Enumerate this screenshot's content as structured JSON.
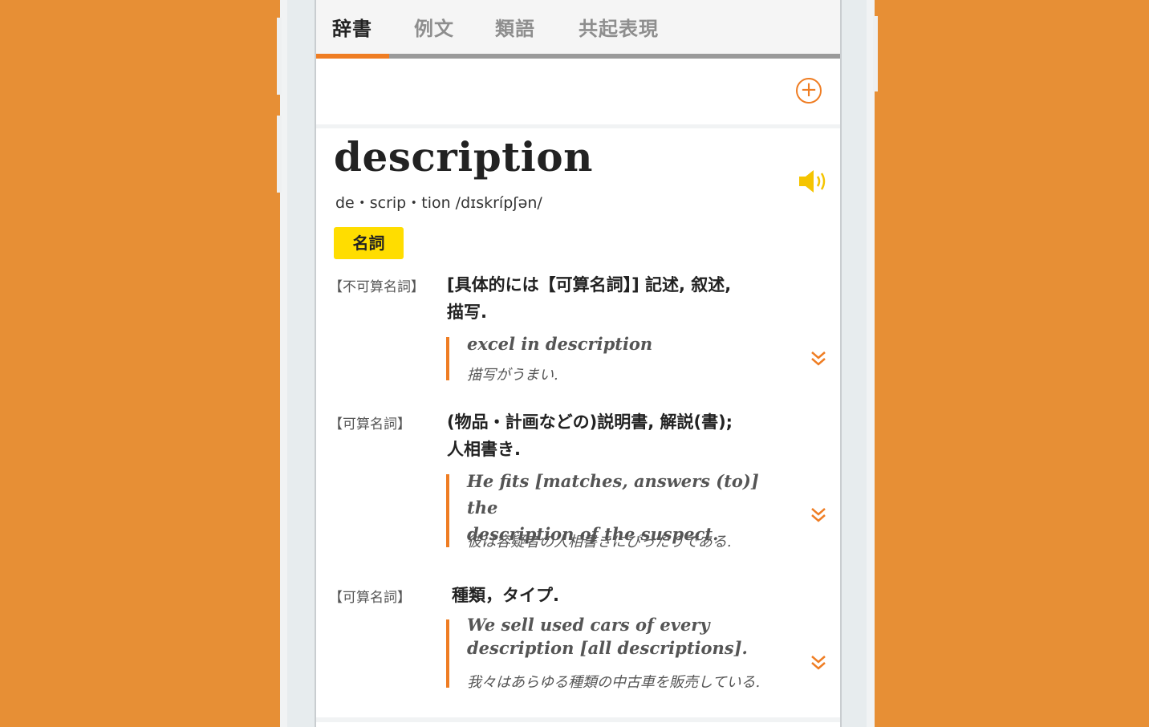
{
  "colors": {
    "background": "#e78f35",
    "accent": "#ef7d23",
    "badge": "#ffdd00",
    "speaker": "#f5c400"
  },
  "tabs": [
    {
      "label": "辞書",
      "active": true
    },
    {
      "label": "例文",
      "active": false
    },
    {
      "label": "類語",
      "active": false
    },
    {
      "label": "共起表現",
      "active": false
    }
  ],
  "toolbar": {
    "add_icon": "plus-circle-icon"
  },
  "entry": {
    "headword": "description",
    "pronunciation": "de・scrip・tion /dɪskrípʃən/",
    "speaker_icon": "speaker-icon",
    "part_of_speech": "名詞"
  },
  "senses": [
    {
      "tag": "【不可算名詞】",
      "def_line1": "[具体的には【可算名詞】] 記述, 叙述,",
      "def_line2": "描写.",
      "example_en_line1": "excel in description",
      "example_en_line2": "",
      "example_ja": "描写がうまい."
    },
    {
      "tag": "【可算名詞】",
      "def_line1": "(物品・計画などの)説明書, 解説(書);",
      "def_line2": "人相書き.",
      "example_en_line1": "He fits [matches, answers (to)] the",
      "example_en_line2": "description of the suspect.",
      "example_ja": "彼は容疑者の人相書きにぴったりである."
    },
    {
      "tag": "【可算名詞】",
      "def_line1": "種類，タイプ.",
      "def_line2": "",
      "example_en_line1": "We sell used cars of every",
      "example_en_line2": "description [all descriptions].",
      "example_ja": "我々はあらゆる種類の中古車を販売している."
    }
  ]
}
